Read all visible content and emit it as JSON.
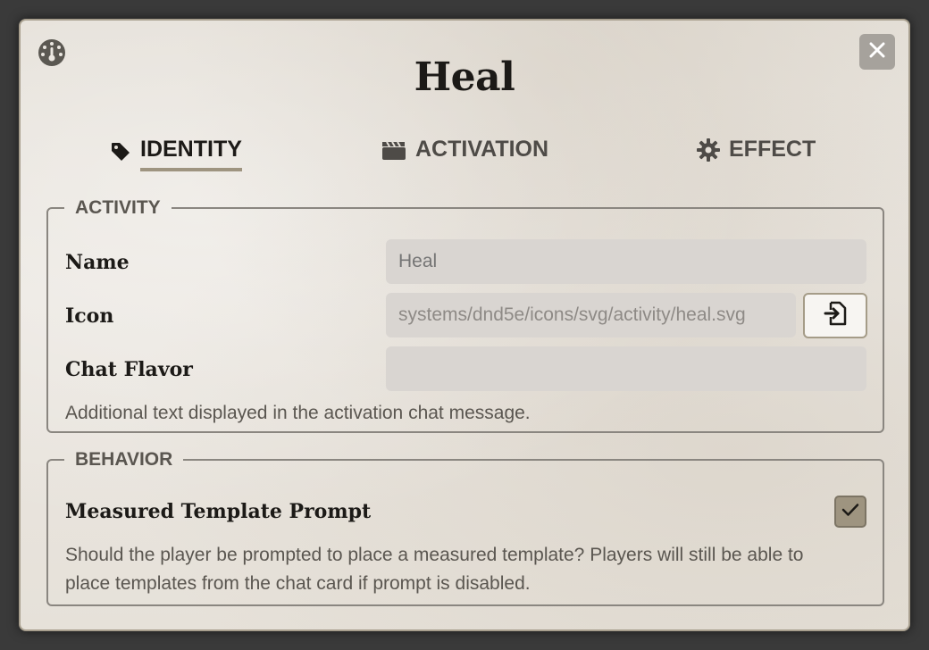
{
  "window": {
    "title": "Heal",
    "header_icon": "dashboard-gauge-icon",
    "close_icon": "close-x-icon"
  },
  "tabs": [
    {
      "label": "IDENTITY",
      "icon": "tag-icon",
      "active": true
    },
    {
      "label": "ACTIVATION",
      "icon": "clapperboard-icon",
      "active": false
    },
    {
      "label": "EFFECT",
      "icon": "gear-icon",
      "active": false
    }
  ],
  "activity": {
    "legend": "ACTIVITY",
    "name_label": "Name",
    "name_placeholder": "Heal",
    "name_value": "",
    "icon_label": "Icon",
    "icon_value": "systems/dnd5e/icons/svg/activity/heal.svg",
    "icon_picker_icon": "file-import-icon",
    "chat_flavor_label": "Chat Flavor",
    "chat_flavor_value": "",
    "chat_flavor_hint": "Additional text displayed in the activation chat message."
  },
  "behavior": {
    "legend": "BEHAVIOR",
    "template_prompt_label": "Measured Template Prompt",
    "template_prompt_checked": true,
    "template_prompt_hint": "Should the player be prompted to place a measured template? Players will still be able to place templates from the chat card if prompt is disabled."
  },
  "colors": {
    "accent": "#9e9480",
    "text_dark": "#1c1a17",
    "field_bg": "#d9d5d1"
  }
}
